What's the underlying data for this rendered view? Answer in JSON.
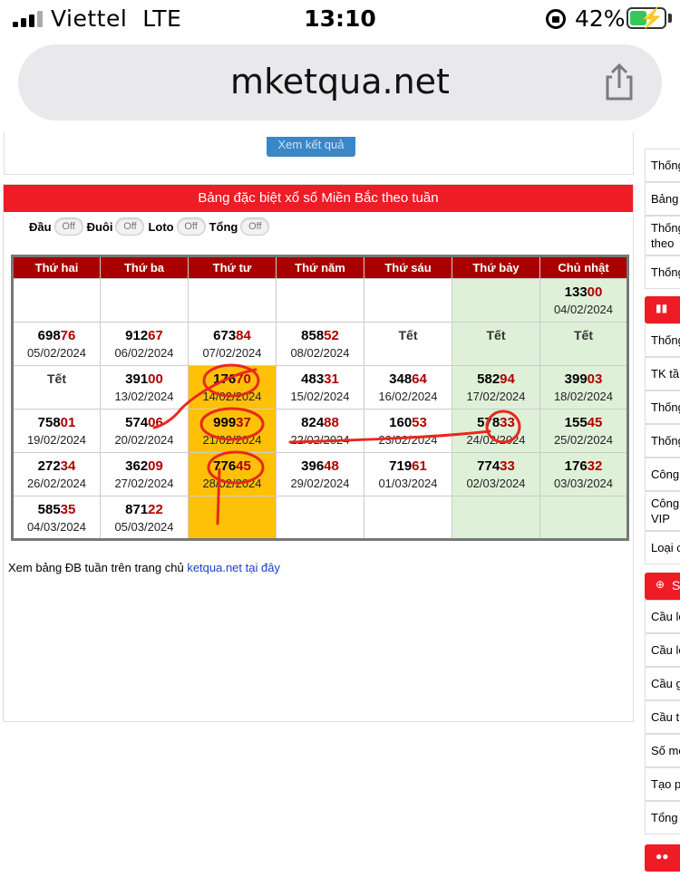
{
  "status_bar": {
    "carrier": "Viettel",
    "network": "LTE",
    "time": "13:10",
    "battery_pct": "42%"
  },
  "browser": {
    "url": "mketqua.net"
  },
  "top_button": "Xem kết quả",
  "panel": {
    "title": "Bảng đặc biệt xổ số Miền Bắc theo tuần",
    "toggles": [
      {
        "label": "Đầu",
        "state": "Off"
      },
      {
        "label": "Đuôi",
        "state": "Off"
      },
      {
        "label": "Loto",
        "state": "Off"
      },
      {
        "label": "Tổng",
        "state": "Off"
      }
    ],
    "headers": [
      "Thứ hai",
      "Thứ ba",
      "Thứ tư",
      "Thứ năm",
      "Thứ sáu",
      "Thứ bảy",
      "Chủ nhật"
    ],
    "rows": [
      [
        {
          "a": "",
          "b": "",
          "date": ""
        },
        {
          "a": "",
          "b": "",
          "date": ""
        },
        {
          "a": "",
          "b": "",
          "date": ""
        },
        {
          "a": "",
          "b": "",
          "date": ""
        },
        {
          "a": "",
          "b": "",
          "date": ""
        },
        {
          "a": "",
          "b": "",
          "date": ""
        },
        {
          "a": "133",
          "b": "00",
          "date": "04/02/2024"
        }
      ],
      [
        {
          "a": "698",
          "b": "76",
          "date": "05/02/2024"
        },
        {
          "a": "912",
          "b": "67",
          "date": "06/02/2024"
        },
        {
          "a": "673",
          "b": "84",
          "date": "07/02/2024"
        },
        {
          "a": "858",
          "b": "52",
          "date": "08/02/2024"
        },
        {
          "tet": "Tết"
        },
        {
          "tet": "Tết"
        },
        {
          "tet": "Tết"
        }
      ],
      [
        {
          "tet": "Tết"
        },
        {
          "a": "391",
          "b": "00",
          "date": "13/02/2024"
        },
        {
          "a": "176",
          "b": "70",
          "date": "14/02/2024"
        },
        {
          "a": "483",
          "b": "31",
          "date": "15/02/2024"
        },
        {
          "a": "348",
          "b": "64",
          "date": "16/02/2024"
        },
        {
          "a": "582",
          "b": "94",
          "date": "17/02/2024"
        },
        {
          "a": "399",
          "b": "03",
          "date": "18/02/2024"
        }
      ],
      [
        {
          "a": "758",
          "b": "01",
          "date": "19/02/2024"
        },
        {
          "a": "574",
          "b": "06",
          "date": "20/02/2024"
        },
        {
          "a": "999",
          "b": "37",
          "date": "21/02/2024"
        },
        {
          "a": "824",
          "b": "88",
          "date": "22/02/2024"
        },
        {
          "a": "160",
          "b": "53",
          "date": "23/02/2024"
        },
        {
          "a": "578",
          "b": "33",
          "date": "24/02/2024"
        },
        {
          "a": "155",
          "b": "45",
          "date": "25/02/2024"
        }
      ],
      [
        {
          "a": "272",
          "b": "34",
          "date": "26/02/2024"
        },
        {
          "a": "362",
          "b": "09",
          "date": "27/02/2024"
        },
        {
          "a": "776",
          "b": "45",
          "date": "28/02/2024"
        },
        {
          "a": "396",
          "b": "48",
          "date": "29/02/2024"
        },
        {
          "a": "719",
          "b": "61",
          "date": "01/03/2024"
        },
        {
          "a": "774",
          "b": "33",
          "date": "02/03/2024"
        },
        {
          "a": "176",
          "b": "32",
          "date": "03/03/2024"
        }
      ],
      [
        {
          "a": "585",
          "b": "35",
          "date": "04/03/2024"
        },
        {
          "a": "871",
          "b": "22",
          "date": "05/03/2024"
        },
        {
          "a": "",
          "b": "",
          "date": ""
        },
        {
          "a": "",
          "b": "",
          "date": ""
        },
        {
          "a": "",
          "b": "",
          "date": ""
        },
        {
          "a": "",
          "b": "",
          "date": ""
        },
        {
          "a": "",
          "b": "",
          "date": ""
        }
      ]
    ],
    "footnote": "Xem bảng ĐB tuần trên trang chủ",
    "footnote_link": "ketqua.net tại đây"
  },
  "sidebar": {
    "items": [
      "Thống",
      "Bảng",
      "Thống theo Đ",
      "Thống",
      "Thống",
      "TK tầ",
      "Thống",
      "Thống",
      "Công",
      "Công VIP",
      "Loại c",
      "Cầu lo",
      "Cầu lo",
      "Cầu g",
      "Cầu t",
      "Số mơ",
      "Tạo p",
      "Tổng"
    ],
    "heads": [
      "chart-icon",
      "search-icon",
      "users-icon"
    ],
    "head_labels": [
      "",
      "S",
      ""
    ]
  },
  "colors": {
    "header_red": "#ee1c25",
    "th_red": "#a80000",
    "highlight": "#ffc107",
    "weekend_green": "#dff0d8",
    "digit_red": "#b00000"
  }
}
